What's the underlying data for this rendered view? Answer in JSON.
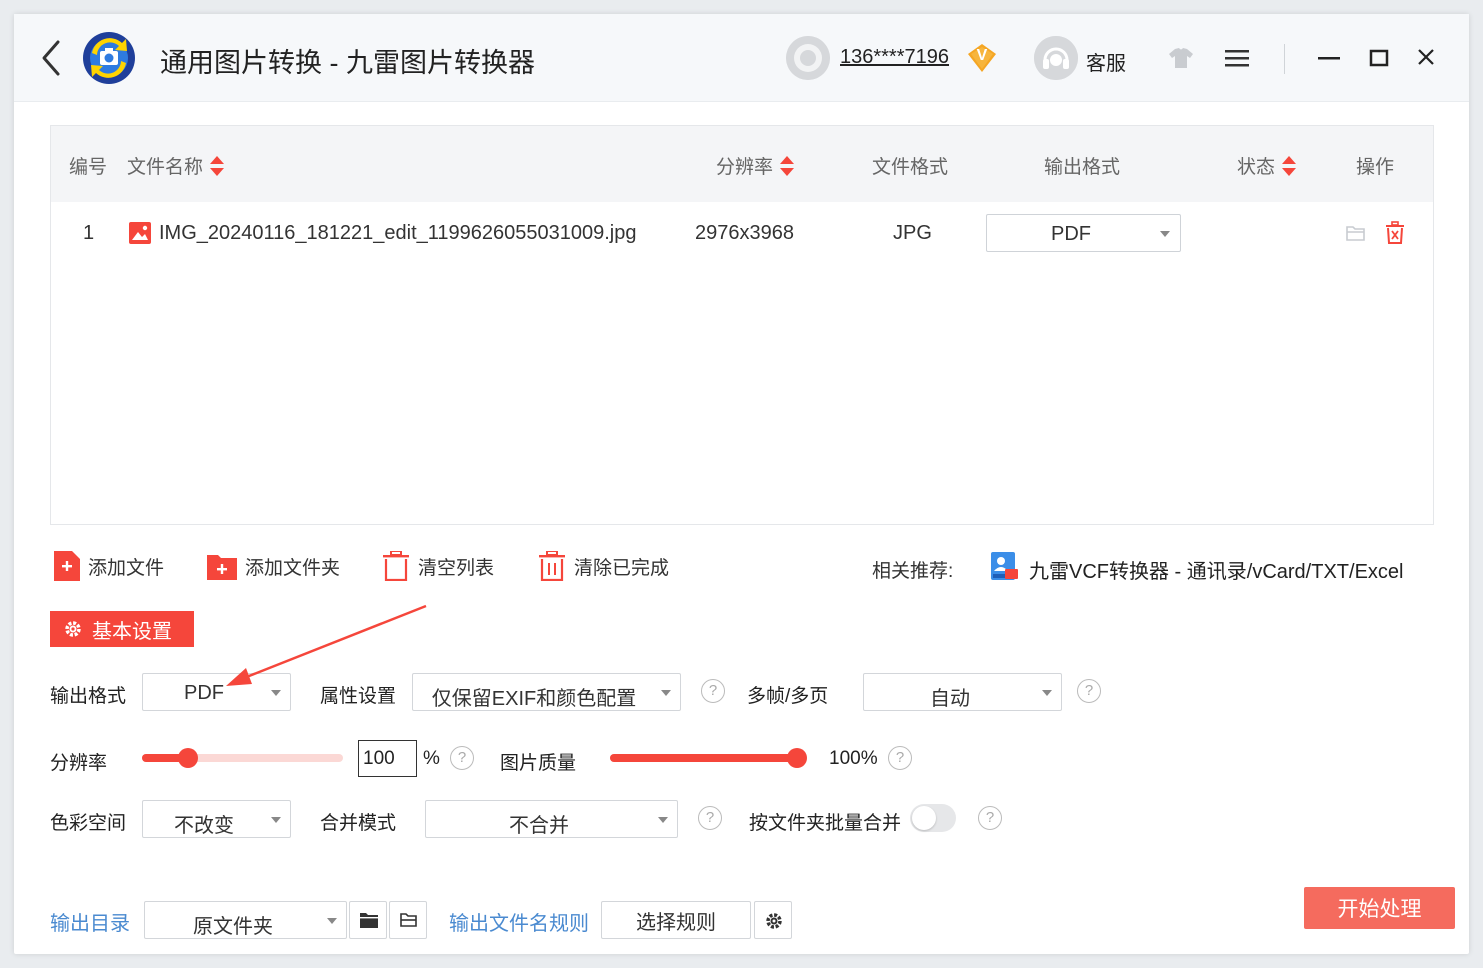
{
  "titlebar": {
    "title": "通用图片转换 - 九雷图片转换器",
    "user_phone": "136****7196",
    "vip_badge": "V",
    "support_label": "客服"
  },
  "table": {
    "headers": {
      "index": "编号",
      "filename": "文件名称",
      "resolution": "分辨率",
      "file_format": "文件格式",
      "output_format": "输出格式",
      "status": "状态",
      "action": "操作"
    },
    "rows": [
      {
        "index": "1",
        "filename": "IMG_20240116_181221_edit_1199626055031009.jpg",
        "resolution": "2976x3968",
        "file_format": "JPG",
        "output_format": "PDF",
        "status": ""
      }
    ]
  },
  "toolbar": {
    "add_file": "添加文件",
    "add_folder": "添加文件夹",
    "clear_list": "清空列表",
    "clear_done": "清除已完成",
    "recommend_label": "相关推荐:",
    "recommend_link": "九雷VCF转换器 - 通讯录/vCard/TXT/Excel"
  },
  "settings": {
    "tab_label": "基本设置",
    "output_format_label": "输出格式",
    "output_format_value": "PDF",
    "attr_label": "属性设置",
    "attr_value": "仅保留EXIF和颜色配置",
    "multiframe_label": "多帧/多页",
    "multiframe_value": "自动",
    "resolution_label": "分辨率",
    "resolution_value": "100",
    "resolution_unit": "%",
    "resolution_slider_fraction": 0.23,
    "quality_label": "图片质量",
    "quality_value": "100%",
    "quality_slider_fraction": 1.0,
    "colorspace_label": "色彩空间",
    "colorspace_value": "不改变",
    "merge_label": "合并模式",
    "merge_value": "不合并",
    "batch_merge_label": "按文件夹批量合并",
    "batch_merge_enabled": false,
    "help_glyph": "?"
  },
  "bottom": {
    "output_dir_label": "输出目录",
    "output_dir_value": "原文件夹",
    "name_rule_label": "输出文件名规则",
    "rule_button": "选择规则",
    "start_button": "开始处理"
  },
  "colors": {
    "accent": "#f5463b",
    "start_button": "#f56b5e",
    "link_blue": "#4a8ad0"
  }
}
